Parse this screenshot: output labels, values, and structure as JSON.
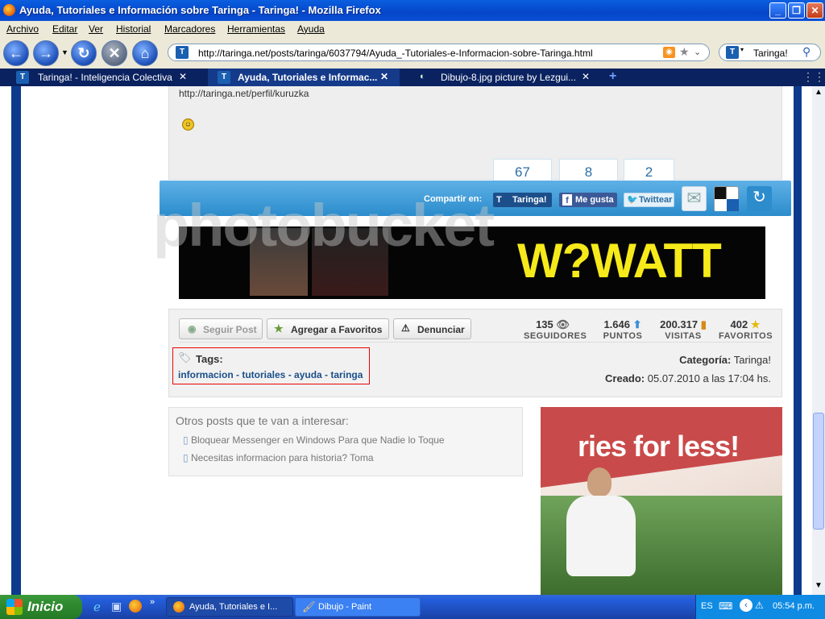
{
  "window": {
    "title": "Ayuda, Tutoriales e Información sobre Taringa - Taringa! - Mozilla Firefox"
  },
  "menu": [
    "Archivo",
    "Editar",
    "Ver",
    "Historial",
    "Marcadores",
    "Herramientas",
    "Ayuda"
  ],
  "nav": {
    "url": "http://taringa.net/posts/taringa/6037794/Ayuda_-Tutoriales-e-Informacion-sobre-Taringa.html",
    "search_value": "Taringa!"
  },
  "tabs": [
    {
      "label": "Taringa! - Inteligencia Colectiva"
    },
    {
      "label": "Ayuda, Tutoriales e Informac..."
    },
    {
      "label": "Dibujo-8.jpg picture by Lezgui..."
    }
  ],
  "post": {
    "profile_link": "http://taringa.net/perfil/kuruzka"
  },
  "share": {
    "label": "Compartir en:",
    "taringa_count": "67",
    "facebook_count": "8",
    "twitter_count": "2",
    "taringa_label": "Taringa!",
    "facebook_label": "Me gusta",
    "twitter_label": "Twittear"
  },
  "banner": {
    "brand": "W?WATT"
  },
  "actions": {
    "follow": "Seguir Post",
    "favorite": "Agregar a Favoritos",
    "report": "Denunciar"
  },
  "stats": [
    {
      "value": "135",
      "label": "SEGUIDORES"
    },
    {
      "value": "1.646",
      "label": "PUNTOS"
    },
    {
      "value": "200.317",
      "label": "VISITAS"
    },
    {
      "value": "402",
      "label": "FAVORITOS"
    }
  ],
  "tags": {
    "title": "Tags:",
    "items": [
      "informacion",
      "tutoriales",
      "ayuda",
      "taringa"
    ],
    "sep": " - "
  },
  "meta": {
    "category_label": "Categoría:",
    "category": "Taringa!",
    "created_label": "Creado:",
    "created": "05.07.2010 a las 17:04 hs."
  },
  "related": {
    "title": "Otros posts que te van a interesar:",
    "items": [
      "Bloquear Messenger en Windows Para que Nadie lo Toque",
      "Necesitas informacion para historia? Toma"
    ]
  },
  "ad": {
    "headline": "ries for less!"
  },
  "watermark": "photobucket",
  "taskbar": {
    "start": "Inicio",
    "tasks": [
      "Ayuda, Tutoriales e I...",
      "Dibujo - Paint"
    ],
    "lang": "ES",
    "time": "05:54 p.m."
  }
}
